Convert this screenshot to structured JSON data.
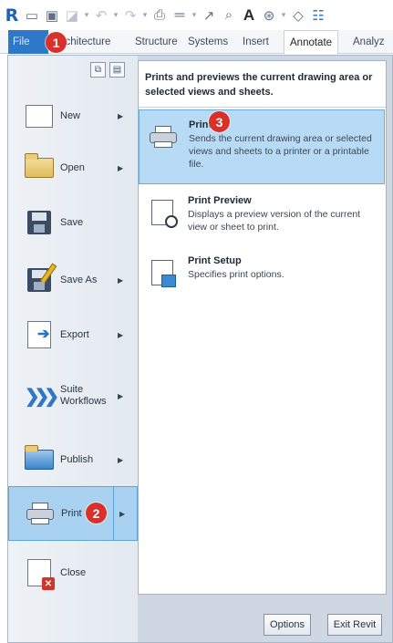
{
  "quick_access": {
    "items": [
      {
        "icon": "revit-logo-icon",
        "glyph": "R"
      },
      {
        "icon": "open-icon",
        "glyph": "▭"
      },
      {
        "icon": "save-icon",
        "glyph": "▣"
      },
      {
        "icon": "sync-icon",
        "glyph": "◪"
      },
      {
        "icon": "undo-icon",
        "glyph": "↶"
      },
      {
        "icon": "redo-icon",
        "glyph": "↷"
      },
      {
        "icon": "print-icon",
        "glyph": "⎙"
      },
      {
        "icon": "measure-icon",
        "glyph": "═"
      },
      {
        "icon": "dimension-icon",
        "glyph": "↗"
      },
      {
        "icon": "tag-icon",
        "glyph": "⌕"
      },
      {
        "icon": "text-icon",
        "glyph": "A"
      },
      {
        "icon": "3d-view-icon",
        "glyph": "⊛"
      },
      {
        "icon": "section-icon",
        "glyph": "◇"
      },
      {
        "icon": "thin-lines-icon",
        "glyph": "☷"
      }
    ]
  },
  "ribbon": {
    "tabs": [
      {
        "label": "File"
      },
      {
        "label": "Architecture"
      },
      {
        "label": "Structure"
      },
      {
        "label": "Systems"
      },
      {
        "label": "Insert"
      },
      {
        "label": "Annotate"
      },
      {
        "label": "Analyz"
      }
    ],
    "active_tab": "Annotate"
  },
  "badges": {
    "one": "1",
    "two": "2",
    "three": "3"
  },
  "app_menu": {
    "items": [
      {
        "label": "New",
        "icon": "new-document-icon",
        "has_submenu": true
      },
      {
        "label": "Open",
        "icon": "open-folder-icon",
        "has_submenu": true
      },
      {
        "label": "Save",
        "icon": "save-icon",
        "has_submenu": false
      },
      {
        "label": "Save As",
        "icon": "save-as-icon",
        "has_submenu": true
      },
      {
        "label": "Export",
        "icon": "export-icon",
        "has_submenu": true
      },
      {
        "label": "Suite Workflows",
        "label_line1": "Suite",
        "label_line2": "Workflows",
        "icon": "suite-workflows-icon",
        "has_submenu": true
      },
      {
        "label": "Publish",
        "icon": "publish-icon",
        "has_submenu": true
      },
      {
        "label": "Print",
        "icon": "printer-icon",
        "has_submenu": true,
        "selected": true
      },
      {
        "label": "Close",
        "icon": "close-document-icon",
        "has_submenu": false
      }
    ]
  },
  "print_panel": {
    "header": "Prints and previews the current drawing area or selected views and sheets.",
    "items": [
      {
        "title": "Print",
        "description": "Sends the current drawing area or selected views and sheets to a printer or a printable file.",
        "icon": "printer-icon",
        "selected": true
      },
      {
        "title": "Print Preview",
        "description": "Displays a preview version of the current view or sheet to print.",
        "icon": "print-preview-icon"
      },
      {
        "title": "Print Setup",
        "description": "Specifies print options.",
        "icon": "print-setup-icon"
      }
    ]
  },
  "footer": {
    "options_label": "Options",
    "exit_label": "Exit Revit"
  },
  "colors": {
    "accent": "#2d78c9",
    "selection": "#a9d2f1",
    "badge": "#d9302a"
  }
}
